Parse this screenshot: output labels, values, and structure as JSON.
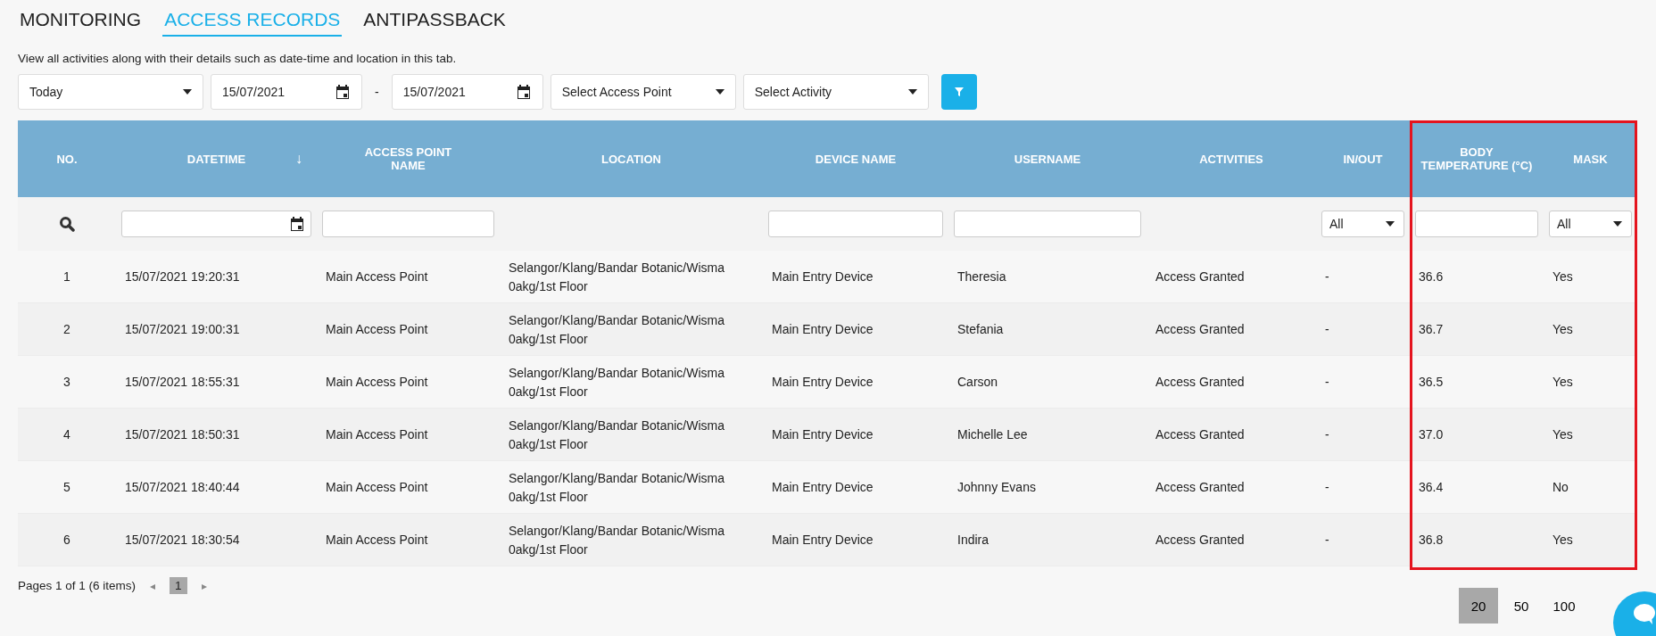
{
  "tabs": [
    {
      "label": "MONITORING",
      "selected": false
    },
    {
      "label": "ACCESS RECORDS",
      "selected": true
    },
    {
      "label": "ANTIPASSBACK",
      "selected": false
    }
  ],
  "description": "View all activities along with their details such as date-time and location in this tab.",
  "filters": [
    {
      "kind": "select",
      "value": "Today"
    },
    {
      "kind": "date",
      "value": "15/07/2021"
    },
    {
      "kind": "separator",
      "value": "-"
    },
    {
      "kind": "date",
      "value": "15/07/2021"
    },
    {
      "kind": "select",
      "value": "Select Access Point"
    },
    {
      "kind": "select",
      "value": "Select Activity"
    },
    {
      "kind": "button"
    }
  ],
  "table": {
    "columns": [
      {
        "label": "NO.",
        "filter": {
          "kind": "search"
        },
        "highlighted": false
      },
      {
        "label": "DATETIME",
        "sort_indicator": "↓",
        "filter": {
          "kind": "date"
        },
        "highlighted": false
      },
      {
        "label": "ACCESS POINT NAME",
        "filter": {
          "kind": "text"
        },
        "highlighted": false
      },
      {
        "label": "LOCATION",
        "highlighted": false
      },
      {
        "label": "DEVICE NAME",
        "filter": {
          "kind": "text"
        },
        "highlighted": false
      },
      {
        "label": "USERNAME",
        "filter": {
          "kind": "text"
        },
        "highlighted": false
      },
      {
        "label": "ACTIVITIES",
        "highlighted": false
      },
      {
        "label": "IN/OUT",
        "filter": {
          "kind": "select",
          "value": "All"
        },
        "highlighted": false
      },
      {
        "label": "BODY TEMPERATURE (°C)",
        "filter": {
          "kind": "text"
        },
        "highlighted": true
      },
      {
        "label": "MASK",
        "filter": {
          "kind": "select",
          "value": "All"
        },
        "highlighted": true
      }
    ],
    "rows": [
      [
        "1",
        "15/07/2021 19:20:31",
        "Main Access Point",
        "Selangor/Klang/Bandar Botanic/Wisma 0akg/1st Floor",
        "Main Entry Device",
        "Theresia",
        "Access Granted",
        "-",
        "36.6",
        "Yes"
      ],
      [
        "2",
        "15/07/2021 19:00:31",
        "Main Access Point",
        "Selangor/Klang/Bandar Botanic/Wisma 0akg/1st Floor",
        "Main Entry Device",
        "Stefania",
        "Access Granted",
        "-",
        "36.7",
        "Yes"
      ],
      [
        "3",
        "15/07/2021 18:55:31",
        "Main Access Point",
        "Selangor/Klang/Bandar Botanic/Wisma 0akg/1st Floor",
        "Main Entry Device",
        "Carson",
        "Access Granted",
        "-",
        "36.5",
        "Yes"
      ],
      [
        "4",
        "15/07/2021 18:50:31",
        "Main Access Point",
        "Selangor/Klang/Bandar Botanic/Wisma 0akg/1st Floor",
        "Main Entry Device",
        "Michelle Lee",
        "Access Granted",
        "-",
        "37.0",
        "Yes"
      ],
      [
        "5",
        "15/07/2021 18:40:44",
        "Main Access Point",
        "Selangor/Klang/Bandar Botanic/Wisma 0akg/1st Floor",
        "Main Entry Device",
        "Johnny Evans",
        "Access Granted",
        "-",
        "36.4",
        "No"
      ],
      [
        "6",
        "15/07/2021 18:30:54",
        "Main Access Point",
        "Selangor/Klang/Bandar Botanic/Wisma 0akg/1st Floor",
        "Main Entry Device",
        "Indira",
        "Access Granted",
        "-",
        "36.8",
        "Yes"
      ]
    ]
  },
  "pager": {
    "summary": "Pages 1 of 1 (6 items)",
    "prev": "◂",
    "pages": [
      {
        "label": "1",
        "selected": true
      }
    ],
    "next": "▸",
    "page_sizes": [
      {
        "label": "20",
        "selected": true
      },
      {
        "label": "50",
        "selected": false
      },
      {
        "label": "100",
        "selected": false
      }
    ]
  },
  "chat_button": true
}
